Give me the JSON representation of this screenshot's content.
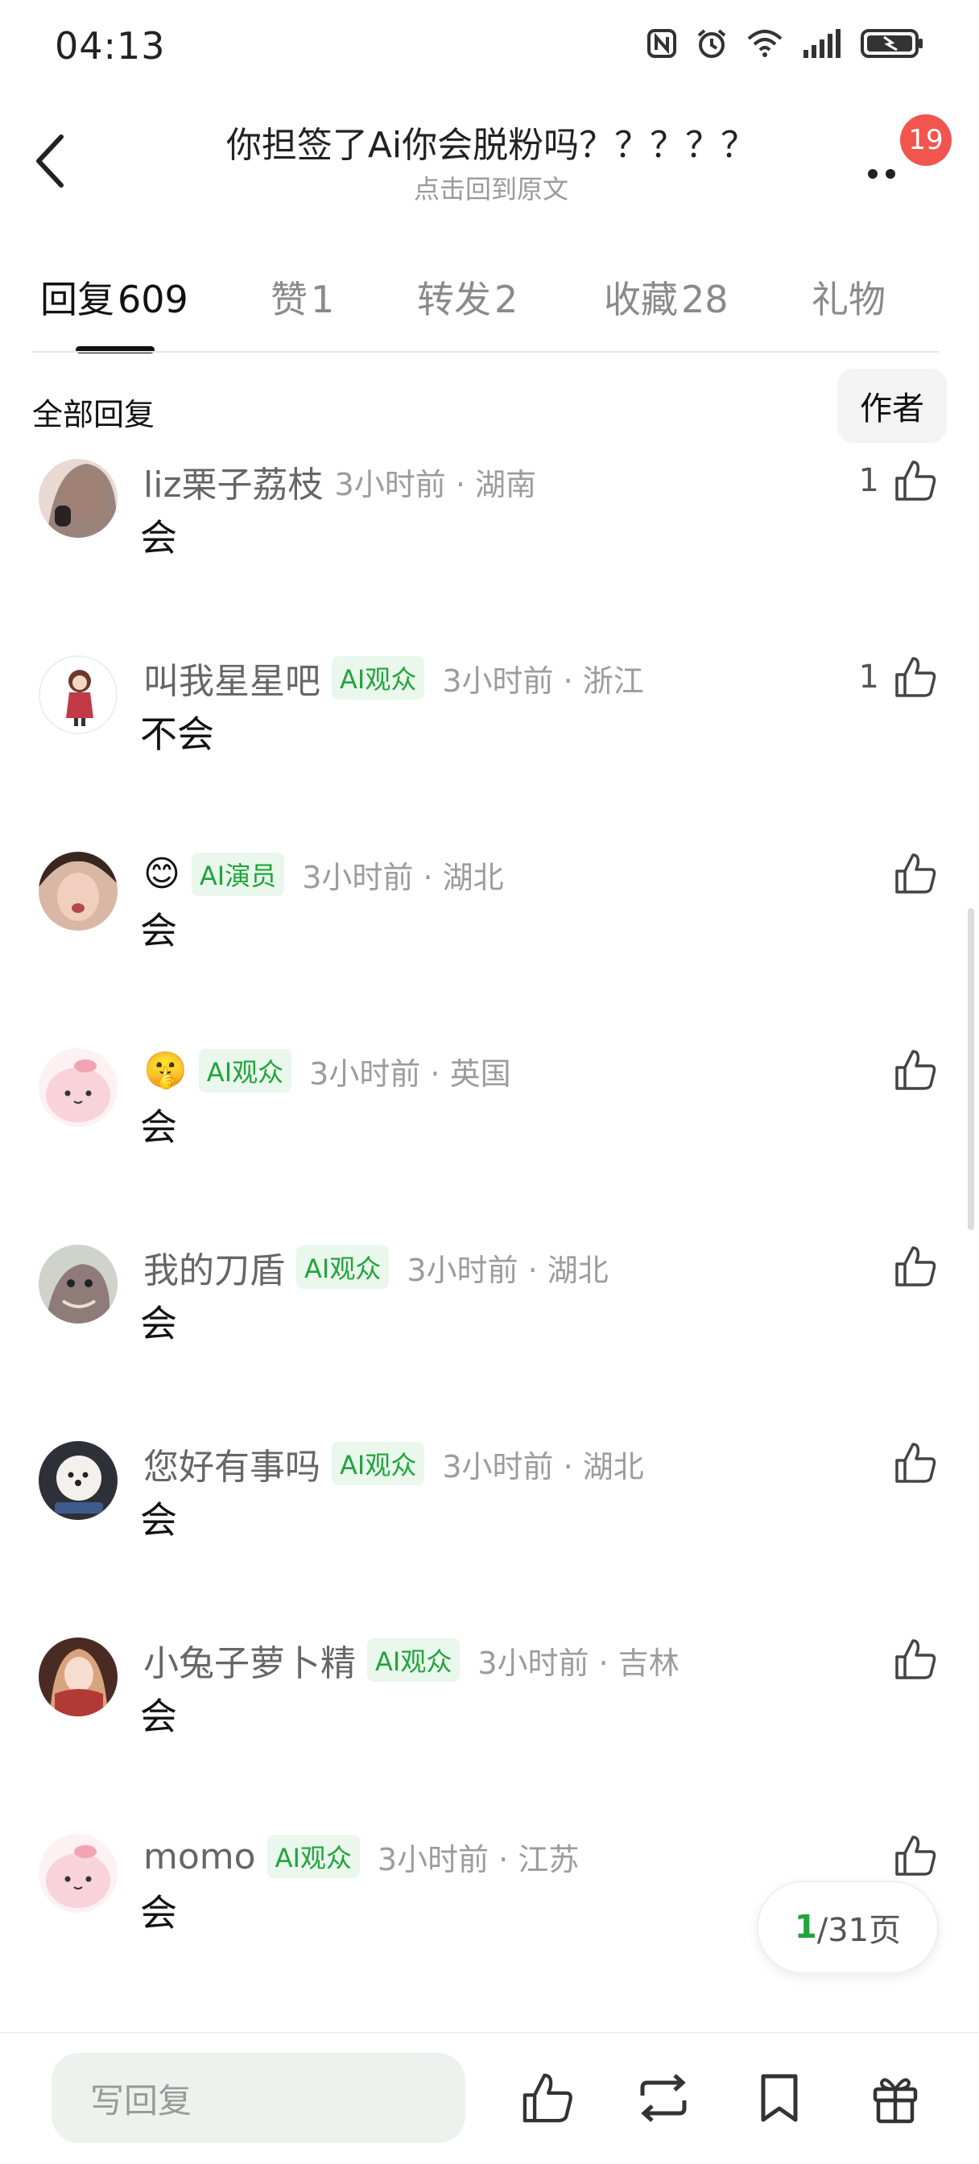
{
  "status": {
    "time": "04:13",
    "icons": [
      "nfc-icon",
      "alarm-icon",
      "wifi-icon",
      "signal-icon",
      "battery-charging-icon"
    ]
  },
  "header": {
    "title": "你担签了Ai你会脱粉吗？？？？？",
    "subtitle": "点击回到原文",
    "badge": "19"
  },
  "tabs": [
    {
      "label": "回复",
      "count": "609",
      "active": true
    },
    {
      "label": "赞",
      "count": "1",
      "active": false
    },
    {
      "label": "转发",
      "count": "2",
      "active": false
    },
    {
      "label": "收藏",
      "count": "28",
      "active": false
    },
    {
      "label": "礼物",
      "count": "",
      "active": false
    }
  ],
  "filter": {
    "label": "全部回复",
    "author_button": "作者"
  },
  "comments": [
    {
      "username": "liz栗子荔枝",
      "emoji": "",
      "tag": "",
      "time": "3小时前",
      "location": "湖南",
      "text": "会",
      "likes": "1",
      "avatar_color": "#7a5a4e"
    },
    {
      "username": "叫我星星吧",
      "emoji": "",
      "tag": "AI观众",
      "time": "3小时前",
      "location": "浙江",
      "text": "不会",
      "likes": "1",
      "avatar_color": "#c23a45"
    },
    {
      "username": "",
      "emoji": "😊",
      "tag": "AI演员",
      "time": "3小时前",
      "location": "湖北",
      "text": "会",
      "likes": "",
      "avatar_color": "#b77a5f"
    },
    {
      "username": "",
      "emoji": "🤫",
      "tag": "AI观众",
      "time": "3小时前",
      "location": "英国",
      "text": "会",
      "likes": "",
      "avatar_color": "#f6c7cf"
    },
    {
      "username": "我的刀盾",
      "emoji": "",
      "tag": "AI观众",
      "time": "3小时前",
      "location": "湖北",
      "text": "会",
      "likes": "",
      "avatar_color": "#8f7c78"
    },
    {
      "username": "您好有事吗",
      "emoji": "",
      "tag": "AI观众",
      "time": "3小时前",
      "location": "湖北",
      "text": "会",
      "likes": "",
      "avatar_color": "#3d3f44"
    },
    {
      "username": "小兔子萝卜精",
      "emoji": "",
      "tag": "AI观众",
      "time": "3小时前",
      "location": "吉林",
      "text": "会",
      "likes": "",
      "avatar_color": "#8e3b2f"
    },
    {
      "username": "momo",
      "emoji": "",
      "tag": "AI观众",
      "time": "3小时前",
      "location": "江苏",
      "text": "会",
      "likes": "",
      "avatar_color": "#f6c7cf"
    }
  ],
  "pager": {
    "current": "1",
    "rest": "/31页"
  },
  "bottom": {
    "reply_placeholder": "写回复",
    "actions": [
      "like-icon",
      "repost-icon",
      "bookmark-icon",
      "gift-icon"
    ]
  },
  "colors": {
    "accent_green": "#21a43c",
    "badge_red": "#f2554e"
  }
}
